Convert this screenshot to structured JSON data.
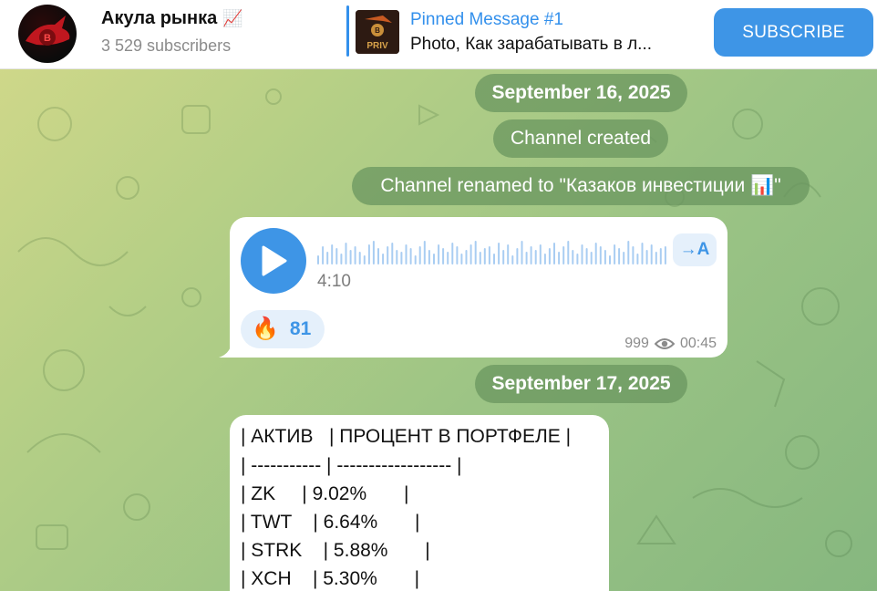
{
  "header": {
    "channel_title": "Акула рынка",
    "channel_title_emoji": "📈",
    "subscribers": "3 529 subscribers",
    "pinned_title": "Pinned Message #1",
    "pinned_text": "Photo, Как зарабатывать в л...",
    "pinned_thumb_text": "PRIV",
    "subscribe_label": "SUBSCRIBE"
  },
  "service": {
    "date1": "September 16, 2025",
    "channel_created": "Channel created",
    "channel_renamed": "Channel renamed to \"Казаков инвестиции 📊\"",
    "date2": "September 17, 2025"
  },
  "voice_message": {
    "duration": "4:10",
    "transcribe_label": "→A",
    "reaction_emoji": "🔥",
    "reaction_count": "81",
    "views": "999",
    "time": "00:45"
  },
  "text_message": {
    "lines": [
      "| АКТИВ   | ПРОЦЕНТ В ПОРТФЕЛЕ |",
      "| ----------- | ------------------ |",
      "| ZK     | 9.02%       |",
      "| TWT    | 6.64%       |",
      "| STRK    | 5.88%       |",
      "| XCH    | 5.30%       |"
    ]
  },
  "icons": {
    "play": "play-icon",
    "eye": "eye-icon",
    "transcribe": "transcribe-icon"
  },
  "colors": {
    "accent": "#3e95e6",
    "service_pill": "#69965f",
    "reaction_bg": "#e5f0fb"
  }
}
